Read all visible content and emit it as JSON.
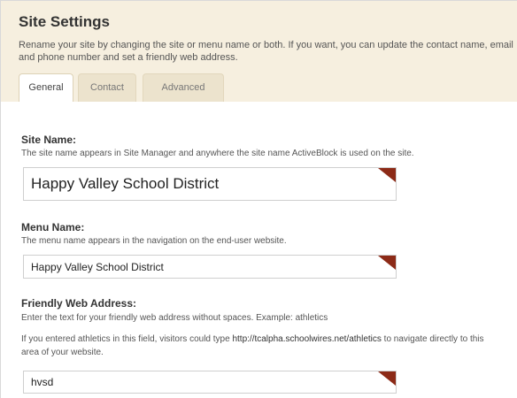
{
  "page": {
    "title": "Site Settings",
    "description": "Rename your site by changing the site or menu name or both. If you want, you can update the contact name, email and phone number and set a friendly web address."
  },
  "tabs": [
    {
      "label": "General",
      "active": true
    },
    {
      "label": "Contact",
      "active": false
    },
    {
      "label": "Advanced",
      "active": false
    }
  ],
  "site_name": {
    "label": "Site Name:",
    "help": "The site name appears in Site Manager and anywhere the site name ActiveBlock is used on the site.",
    "value": "Happy Valley School District"
  },
  "menu_name": {
    "label": "Menu Name:",
    "help": "The menu name appears in the navigation on the end-user website.",
    "value": "Happy Valley School District"
  },
  "friendly_address": {
    "label": "Friendly Web Address:",
    "help1": "Enter the text for your friendly web address without spaces. Example: athletics",
    "help2_before": "If you entered athletics in this field, visitors could type ",
    "help2_url": "http://tcalpha.schoolwires.net/athletics",
    "help2_after": " to navigate directly to this area of your website.",
    "value": "hvsd"
  },
  "colors": {
    "header_bg": "#f6efdf",
    "corner_accent": "#8c2a17"
  }
}
